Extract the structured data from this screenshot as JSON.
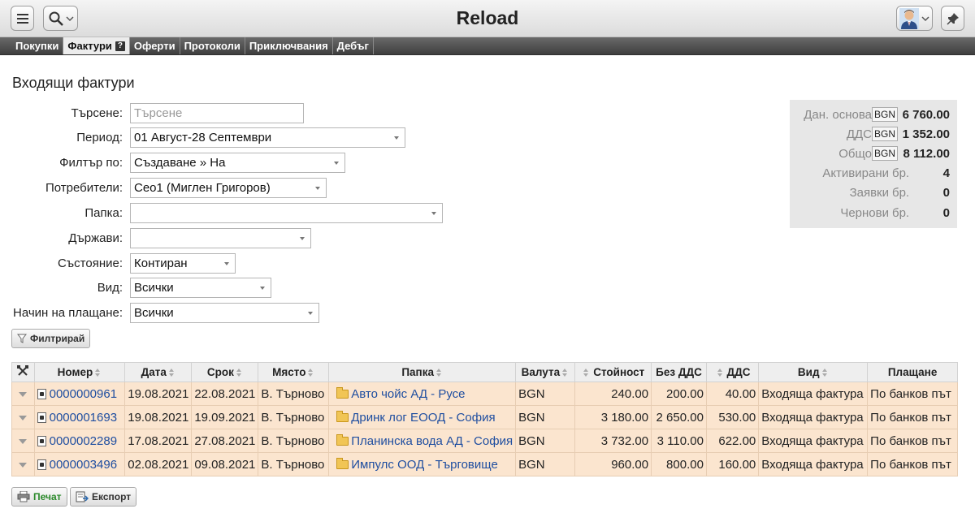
{
  "header": {
    "title": "Reload",
    "menu_icon": "hamburger-icon",
    "search_icon": "magnifier-icon",
    "avatar_icon": "user-avatar-icon",
    "pin_icon": "pin-icon"
  },
  "nav": {
    "tabs": [
      {
        "label": "Покупки",
        "active": false
      },
      {
        "label": "Фактури",
        "active": true,
        "help": "?"
      },
      {
        "label": "Оферти",
        "active": false
      },
      {
        "label": "Протоколи",
        "active": false
      },
      {
        "label": "Приключвания",
        "active": false
      },
      {
        "label": "Дебъг",
        "active": false
      }
    ]
  },
  "page": {
    "title": "Входящи фактури"
  },
  "filters": {
    "search": {
      "label": "Търсене:",
      "placeholder": "Търсене",
      "value": ""
    },
    "period": {
      "label": "Период:",
      "value": "01 Август-28 Септември"
    },
    "filter_by": {
      "label": "Филтър по:",
      "value": "Създаване » На"
    },
    "users": {
      "label": "Потребители:",
      "value": "Ceo1 (Миглен Григоров)"
    },
    "folder": {
      "label": "Папка:",
      "value": ""
    },
    "countries": {
      "label": "Държави:",
      "value": ""
    },
    "state": {
      "label": "Състояние:",
      "value": "Контиран"
    },
    "kind": {
      "label": "Вид:",
      "value": "Всички"
    },
    "payment": {
      "label": "Начин на плащане:",
      "value": "Всички"
    },
    "filter_button": "Филтрирай"
  },
  "summary": {
    "rows": [
      {
        "label": "Дан. основа",
        "currency": "BGN",
        "value": "6 760.00"
      },
      {
        "label": "ДДС",
        "currency": "BGN",
        "value": "1 352.00"
      },
      {
        "label": "Общо",
        "currency": "BGN",
        "value": "8 112.00"
      },
      {
        "label": "Активирани",
        "unit": "бр.",
        "value": "4"
      },
      {
        "label": "Заявки",
        "unit": "бр.",
        "value": "0"
      },
      {
        "label": "Чернови",
        "unit": "бр.",
        "value": "0"
      }
    ]
  },
  "table": {
    "tools_icon": "tools-icon",
    "columns": [
      "Номер",
      "Дата",
      "Срок",
      "Място",
      "Папка",
      "Валута",
      "Стойност",
      "Без ДДС",
      "ДДС",
      "Вид",
      "Плащане"
    ],
    "rows": [
      {
        "number": "0000000961",
        "date": "19.08.2021",
        "due": "22.08.2021",
        "place": "В. Търново",
        "folder": "Авто чойс АД - Русе",
        "currency": "BGN",
        "value": "240.00",
        "net": "200.00",
        "vat": "40.00",
        "kind": "Входяща фактура",
        "payment": "По банков път"
      },
      {
        "number": "0000001693",
        "date": "19.08.2021",
        "due": "19.09.2021",
        "place": "В. Търново",
        "folder": "Дринк лог ЕООД - София",
        "currency": "BGN",
        "value": "3 180.00",
        "net": "2 650.00",
        "vat": "530.00",
        "kind": "Входяща фактура",
        "payment": "По банков път"
      },
      {
        "number": "0000002289",
        "date": "17.08.2021",
        "due": "27.08.2021",
        "place": "В. Търново",
        "folder": "Планинска вода АД - София",
        "currency": "BGN",
        "value": "3 732.00",
        "net": "3 110.00",
        "vat": "622.00",
        "kind": "Входяща фактура",
        "payment": "По банков път"
      },
      {
        "number": "0000003496",
        "date": "02.08.2021",
        "due": "09.08.2021",
        "place": "В. Търново",
        "folder": "Импулс ООД - Търговище",
        "currency": "BGN",
        "value": "960.00",
        "net": "800.00",
        "vat": "160.00",
        "kind": "Входяща фактура",
        "payment": "По банков път"
      }
    ]
  },
  "footer": {
    "print_button": "Печат",
    "export_button": "Експорт"
  },
  "colors": {
    "row_background": "#fbe5cf",
    "link": "#1f4ea0",
    "nav_background": "#4a4a4a",
    "print_label": "#2a8a2a"
  }
}
